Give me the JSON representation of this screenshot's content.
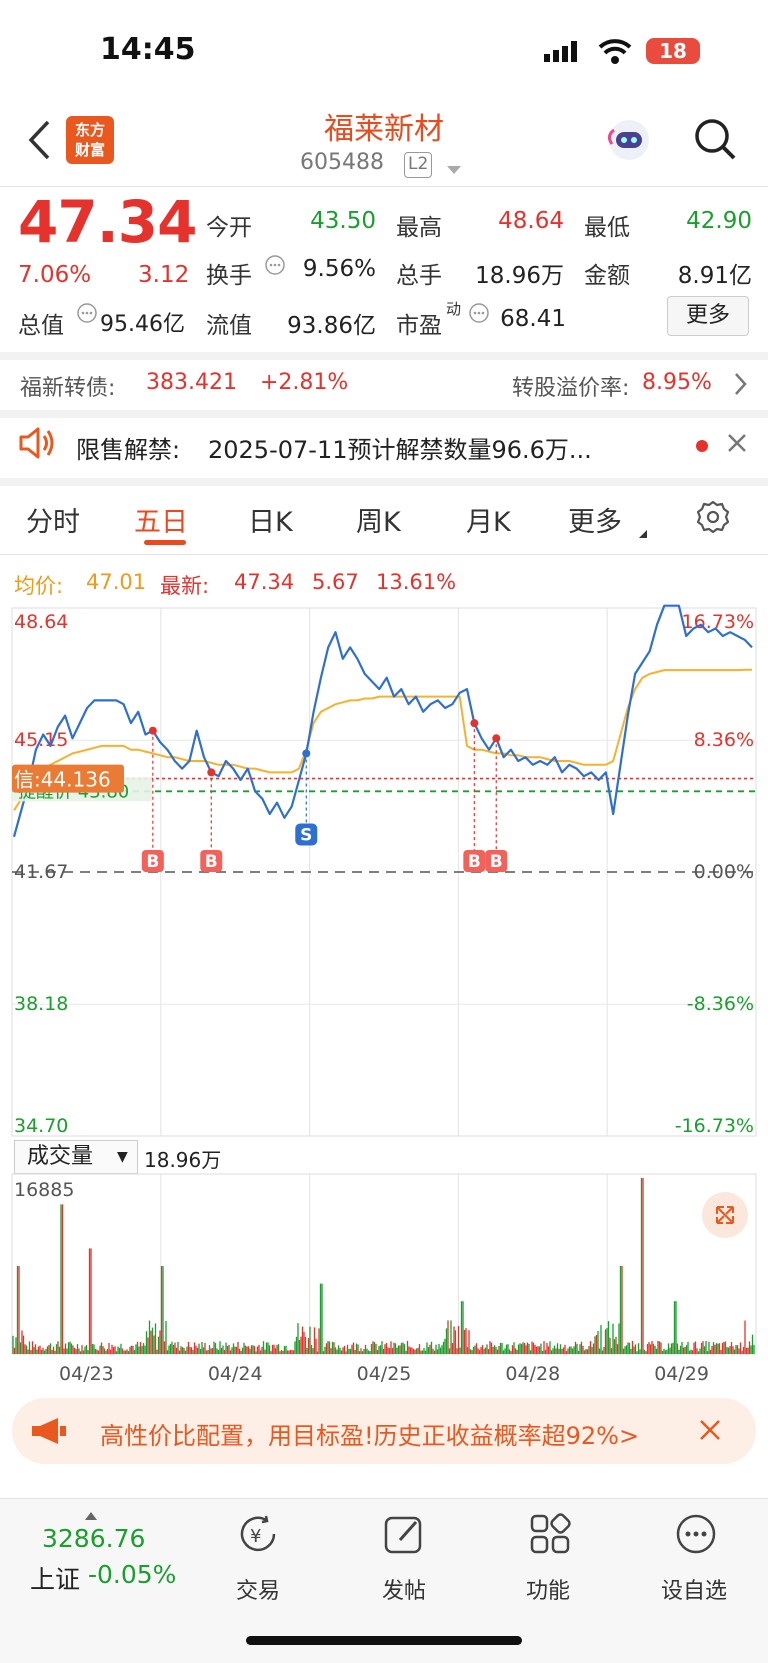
{
  "status_bar": {
    "time": "14:45",
    "battery": "18"
  },
  "header": {
    "logo_text": "东方\n财富",
    "title": "福莱新材",
    "code": "605488",
    "level_badge": "L2"
  },
  "quote": {
    "price": "47.34",
    "change_pct": "7.06%",
    "change": "3.12",
    "metrics": [
      {
        "label": "今开",
        "value": "43.50",
        "color": "green"
      },
      {
        "label": "最高",
        "value": "48.64",
        "color": "red"
      },
      {
        "label": "最低",
        "value": "42.90",
        "color": "green"
      },
      {
        "label": "换手",
        "value": "9.56%",
        "color": "dark"
      },
      {
        "label": "总手",
        "value": "18.96万",
        "color": "dark"
      },
      {
        "label": "金额",
        "value": "8.91亿",
        "color": "dark"
      },
      {
        "label": "总值",
        "value": "95.46亿",
        "color": "dark"
      },
      {
        "label": "流值",
        "value": "93.86亿",
        "color": "dark"
      },
      {
        "label": "市盈",
        "sup": "动",
        "value": "68.41",
        "color": "dark"
      }
    ],
    "more_label": "更多"
  },
  "convertible": {
    "label": "福新转债:",
    "price": "383.421",
    "change": "+2.81%",
    "premium_label": "转股溢价率:",
    "premium": "8.95%"
  },
  "notice": {
    "title": "限售解禁:",
    "text": "2025-07-11预计解禁数量96.6万..."
  },
  "tabs": [
    "分时",
    "五日",
    "日K",
    "周K",
    "月K",
    "更多"
  ],
  "active_tab": "五日",
  "chart_info": {
    "avg_label": "均价:",
    "avg_value": "47.01",
    "latest_label": "最新:",
    "latest_value": "47.34",
    "change": "5.67",
    "change_pct": "13.61%"
  },
  "chart_data": {
    "type": "line",
    "x_labels": [
      "04/23",
      "04/24",
      "04/25",
      "04/28",
      "04/29"
    ],
    "y_left_ticks": [
      "48.64",
      "45.15",
      "41.67",
      "38.18",
      "34.70"
    ],
    "y_right_ticks": [
      "16.73%",
      "8.36%",
      "0.00%",
      "-8.36%",
      "-16.73%"
    ],
    "ylim": [
      34.7,
      48.64
    ],
    "reference_price": 41.67,
    "credit_line_label": "信:44.136",
    "credit_line_value": 44.136,
    "alert_line_label": "提醒价 43.80",
    "alert_line_value": 43.8,
    "series": [
      {
        "name": "价格",
        "color": "#2f6fd0",
        "values": [
          42.6,
          43.3,
          44.0,
          44.9,
          45.3,
          45.0,
          45.5,
          45.8,
          45.2,
          45.6,
          46.0,
          46.2,
          46.2,
          46.2,
          46.2,
          46.1,
          45.6,
          45.9,
          45.3,
          45.4,
          45.1,
          44.9,
          44.6,
          44.4,
          44.6,
          45.4,
          44.7,
          44.3,
          44.2,
          44.6,
          44.4,
          44.1,
          44.4,
          43.8,
          43.6,
          43.2,
          43.5,
          43.1,
          43.4,
          44.1,
          44.8,
          45.9,
          46.8,
          47.6,
          48.0,
          47.3,
          47.6,
          47.3,
          46.9,
          46.7,
          46.5,
          46.8,
          46.3,
          46.5,
          46.1,
          46.3,
          45.9,
          46.1,
          46.2,
          46.0,
          46.1,
          46.4,
          46.5,
          45.6,
          45.2,
          44.9,
          45.2,
          44.7,
          44.9,
          44.6,
          44.7,
          44.5,
          44.6,
          44.5,
          44.7,
          44.3,
          44.5,
          44.4,
          44.2,
          44.3,
          44.1,
          44.3,
          43.2,
          44.5,
          45.8,
          46.9,
          47.2,
          47.5,
          48.2,
          48.7,
          48.7,
          48.7,
          47.9,
          48.1,
          48.2,
          48.0,
          48.1,
          47.9,
          48.0,
          47.9,
          47.8,
          47.6
        ],
        "desc": ""
      },
      {
        "name": "均价",
        "color": "#f6b12e",
        "values": [
          43.3,
          43.6,
          43.9,
          44.2,
          44.4,
          44.5,
          44.6,
          44.7,
          44.8,
          44.85,
          44.9,
          44.95,
          45.0,
          45.0,
          45.0,
          45.0,
          44.9,
          44.9,
          44.85,
          44.8,
          44.75,
          44.7,
          44.7,
          44.65,
          44.6,
          44.6,
          44.6,
          44.55,
          44.5,
          44.5,
          44.5,
          44.45,
          44.4,
          44.4,
          44.35,
          44.3,
          44.3,
          44.3,
          44.3,
          44.4,
          44.9,
          45.6,
          45.9,
          46.0,
          46.1,
          46.15,
          46.2,
          46.2,
          46.25,
          46.25,
          46.3,
          46.3,
          46.3,
          46.3,
          46.3,
          46.3,
          46.3,
          46.3,
          46.3,
          46.3,
          46.3,
          46.3,
          45.0,
          44.9,
          44.9,
          44.85,
          44.8,
          44.8,
          44.75,
          44.75,
          44.7,
          44.7,
          44.7,
          44.65,
          44.6,
          44.6,
          44.6,
          44.55,
          44.5,
          44.5,
          44.5,
          44.5,
          44.6,
          45.3,
          46.0,
          46.5,
          46.8,
          46.9,
          46.95,
          47.0,
          47.0,
          47.0,
          47.0,
          47.0,
          47.0,
          47.0,
          47.0,
          47.0,
          47.0,
          47.0,
          47.01,
          47.01
        ]
      }
    ],
    "markers": [
      {
        "label": "B",
        "type": "buy",
        "index": 19
      },
      {
        "label": "B",
        "type": "buy",
        "index": 27
      },
      {
        "label": "S",
        "type": "sell",
        "index": 40
      },
      {
        "label": "B",
        "type": "buy",
        "index": 63
      },
      {
        "label": "B",
        "type": "buy",
        "index": 66
      }
    ]
  },
  "volume": {
    "selector": "成交量",
    "total": "18.96万",
    "max_label": "16885",
    "x_labels": [
      "04/23",
      "04/24",
      "04/25",
      "04/28",
      "04/29"
    ]
  },
  "promo": {
    "text": "高性价比配置，用目标盈!历史正收益概率超92%>"
  },
  "bottom_nav": {
    "index_value": "3286.76",
    "index_name": "上证",
    "index_change": "-0.05%",
    "items": [
      {
        "label": "交易",
        "icon": "yuan-icon"
      },
      {
        "label": "发帖",
        "icon": "edit-icon"
      },
      {
        "label": "功能",
        "icon": "grid-icon"
      },
      {
        "label": "设自选",
        "icon": "more-icon"
      }
    ]
  }
}
